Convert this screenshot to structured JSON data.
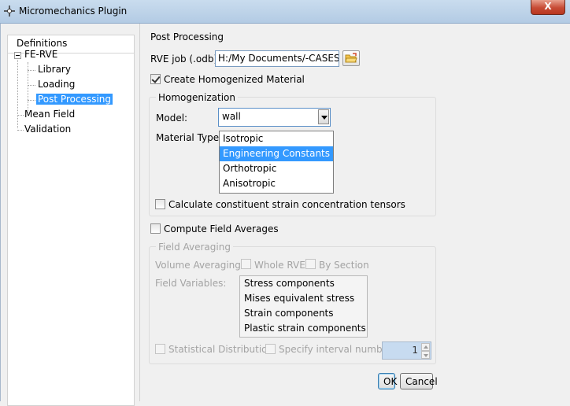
{
  "window": {
    "title": "Micromechanics Plugin",
    "close_glyph": "X"
  },
  "tree": {
    "header": "Definitions",
    "root": "FE-RVE",
    "children": [
      "Library",
      "Loading",
      "Post Processing"
    ],
    "selected": "Post Processing",
    "siblings": [
      "Mean Field",
      "Validation"
    ]
  },
  "post_processing": {
    "title": "Post Processing",
    "rve_job_label": "RVE job (.odb):",
    "rve_job_value": "H:/My Documents/-CASES/k",
    "create_homogenized_label": "Create Homogenized Material",
    "create_homogenized_checked": true
  },
  "homogenization": {
    "title": "Homogenization",
    "model_label": "Model:",
    "model_value": "wall",
    "material_type_label": "Material Type:",
    "material_type_options": [
      "Isotropic",
      "Engineering Constants",
      "Orthotropic",
      "Anisotropic"
    ],
    "material_type_highlighted": "Engineering Constants",
    "strain_tensors_label": "Calculate constituent strain concentration tensors",
    "strain_tensors_checked": false
  },
  "field_averages": {
    "compute_label": "Compute Field Averages",
    "compute_checked": false
  },
  "field_averaging": {
    "title": "Field Averaging",
    "volume_averaging_label": "Volume Averaging:",
    "whole_rve_label": "Whole RVE",
    "by_section_label": "By Section",
    "field_variables_label": "Field Variables:",
    "field_variables": [
      "Stress components",
      "Mises equivalent stress",
      "Strain components",
      "Plastic strain components"
    ],
    "statistical_label": "Statistical Distribution",
    "interval_label": "Specify interval number",
    "interval_value": "1"
  },
  "buttons": {
    "ok": "OK",
    "cancel": "Cancel"
  },
  "colors": {
    "selection": "#3399ff",
    "disabled_text": "#a3a3a3",
    "close_button": "#c74b35"
  }
}
